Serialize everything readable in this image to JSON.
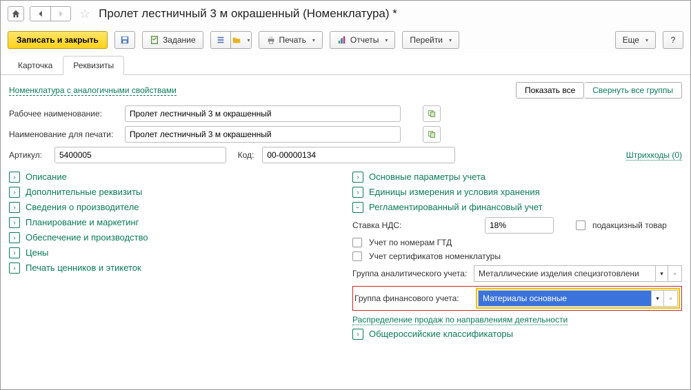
{
  "title": "Пролет лестничный 3 м окрашенный (Номенклатура) *",
  "toolbar": {
    "save_close": "Записать и закрыть",
    "task": "Задание",
    "print": "Печать",
    "reports": "Отчеты",
    "goto": "Перейти",
    "more": "Еще"
  },
  "tabs": {
    "card": "Карточка",
    "details": "Реквизиты"
  },
  "header": {
    "similar_link": "Номенклатура с аналогичными свойствами",
    "show_all": "Показать все",
    "collapse_all": "Свернуть все группы"
  },
  "fields": {
    "work_name_label": "Рабочее наименование:",
    "work_name": "Пролет лестничный 3 м окрашенный",
    "print_name_label": "Наименование для печати:",
    "print_name": "Пролет лестничный 3 м окрашенный",
    "article_label": "Артикул:",
    "article": "5400005",
    "code_label": "Код:",
    "code": "00-00000134",
    "barcodes": "Штрихкоды (0)"
  },
  "left_sections": [
    "Описание",
    "Дополнительные реквизиты",
    "Сведения о производителе",
    "Планирование и маркетинг",
    "Обеспечение и производство",
    "Цены",
    "Печать ценников и этикеток"
  ],
  "right": {
    "main_params": "Основные параметры учета",
    "units": "Единицы измерения и условия хранения",
    "reglament": "Регламентированный и финансовый учет",
    "vat_label": "Ставка НДС:",
    "vat_value": "18%",
    "excise_label": "подакцизный товар",
    "gtd_label": "Учет по номерам ГТД",
    "cert_label": "Учет сертификатов номенклатуры",
    "analytic_group_label": "Группа аналитического учета:",
    "analytic_group": "Металлические изделия специзготовлени",
    "fin_group_label": "Группа финансового учета:",
    "fin_group": "Материалы основные",
    "sales_distrib": "Распределение продаж по направлениям деятельности",
    "classifiers": "Общероссийские классификаторы"
  }
}
